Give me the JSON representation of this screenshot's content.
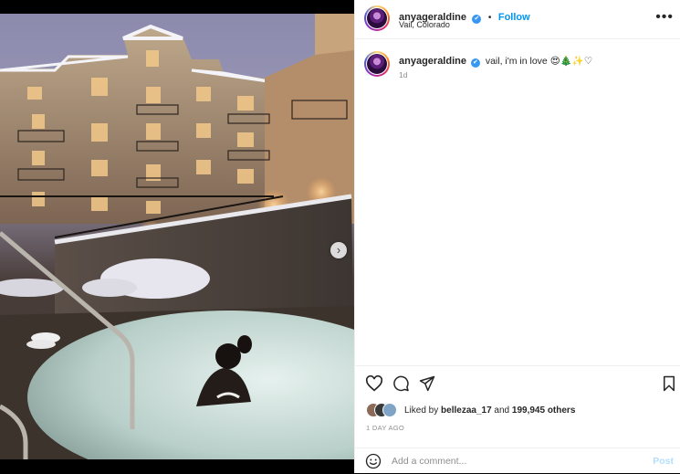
{
  "post": {
    "username": "anyageraldine",
    "verified_mark": "✔",
    "separator": "•",
    "follow_label": "Follow",
    "location": "Vail, Colorado",
    "more_label": "•••",
    "caption": {
      "username": "anyageraldine",
      "text": "vail, i'm in love 😍🎄✨♡",
      "time": "1d"
    },
    "likes": {
      "prefix": "Liked by ",
      "user": "bellezaa_17",
      "middle": " and ",
      "count": "199,945 others"
    },
    "date": "1 DAY AGO",
    "comment": {
      "placeholder": "Add a comment...",
      "post_label": "Post"
    }
  },
  "media": {
    "next_glyph": "›",
    "carousel_active_index": 0,
    "carousel_count": 2
  },
  "icons": [
    "verified-icon",
    "more-icon",
    "heart-icon",
    "comment-icon",
    "share-icon",
    "bookmark-icon",
    "emoji-icon",
    "next-arrow-icon"
  ],
  "colors": {
    "accent": "#0095f6",
    "text": "#262626",
    "muted": "#8e8e8e",
    "post_disabled": "#b2dffc"
  }
}
